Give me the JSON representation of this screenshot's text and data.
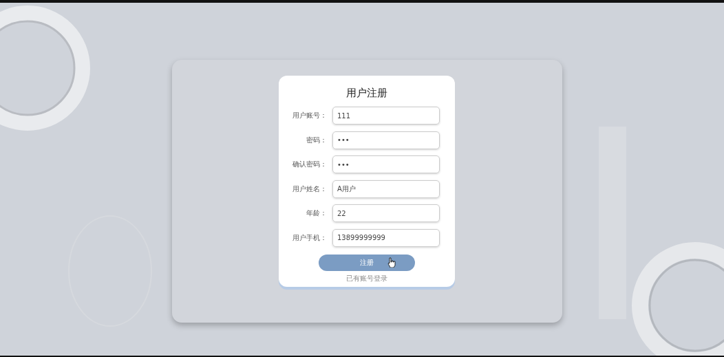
{
  "form": {
    "title": "用户注册",
    "fields": [
      {
        "label": "用户账号：",
        "value": "111"
      },
      {
        "label": "密码：",
        "value": "•••"
      },
      {
        "label": "确认密码：",
        "value": "•••"
      },
      {
        "label": "用户姓名：",
        "value": "A用户"
      },
      {
        "label": "年龄：",
        "value": "22"
      },
      {
        "label": "用户手机：",
        "value": "13899999999"
      }
    ],
    "submit": "注册",
    "login_link": "已有账号登录"
  }
}
